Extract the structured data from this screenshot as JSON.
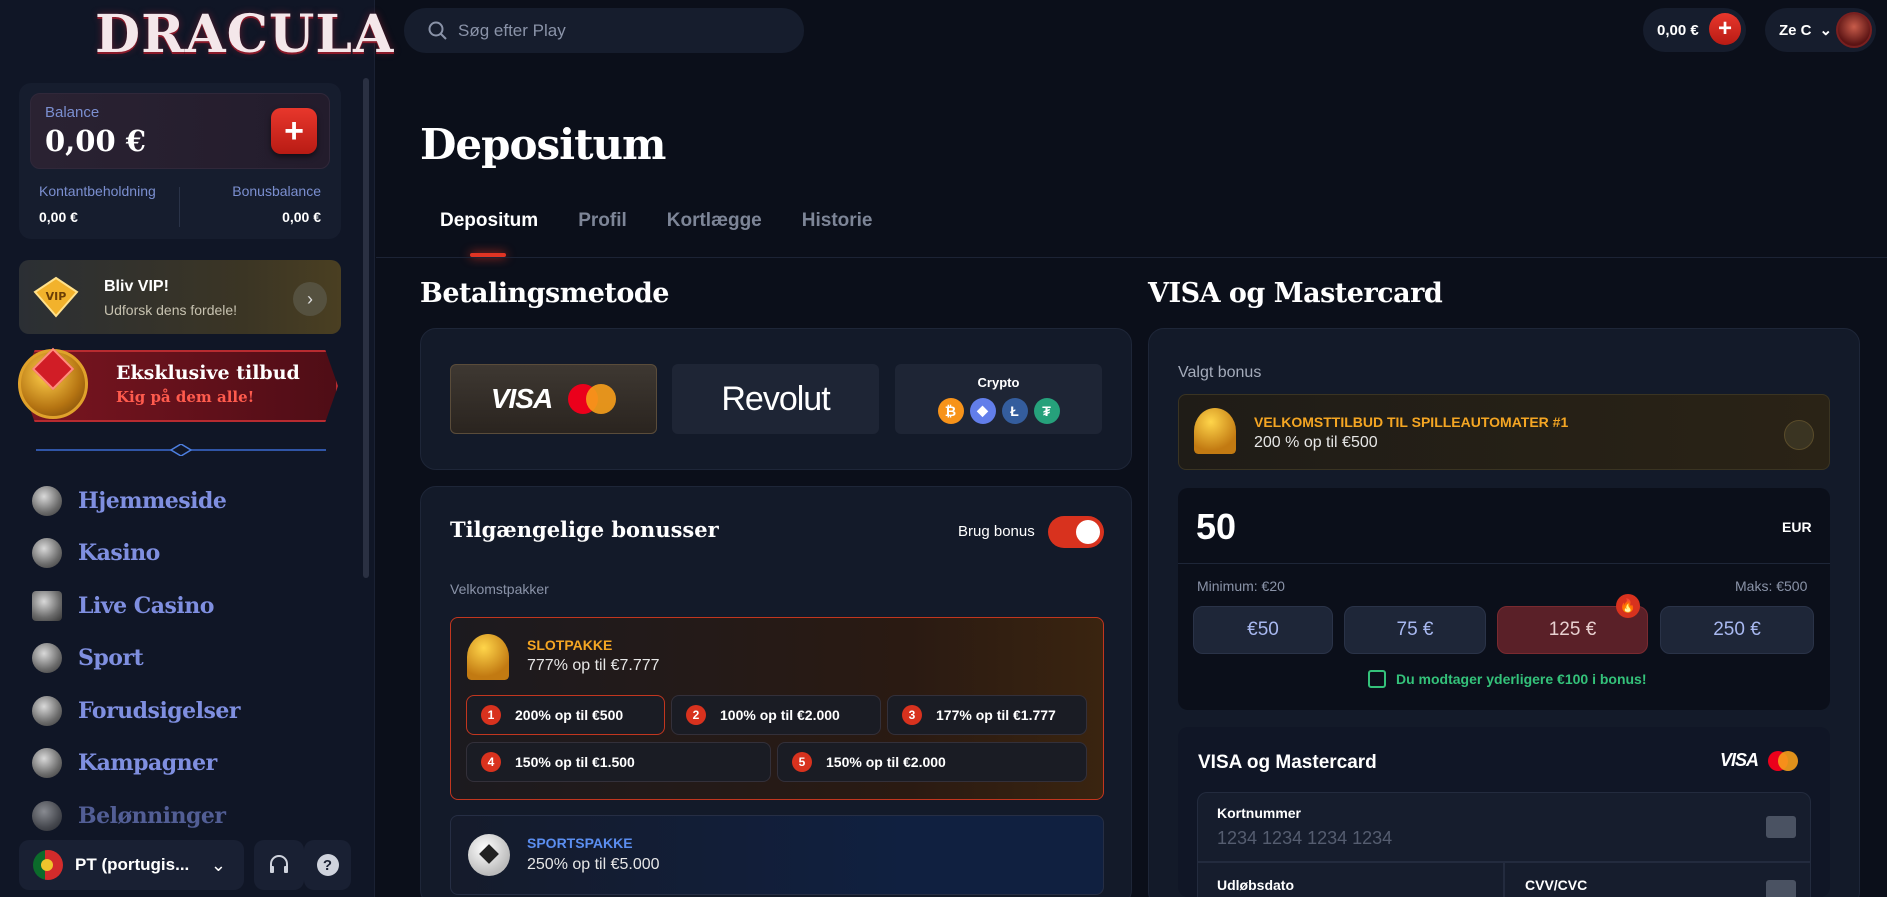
{
  "sidebar": {
    "logo": "DRACULA",
    "balance": {
      "label": "Balance",
      "value": "0,00 €"
    },
    "cash": {
      "label": "Kontantbeholdning",
      "value": "0,00 €"
    },
    "bonus": {
      "label": "Bonusbalance",
      "value": "0,00 €"
    },
    "vip": {
      "badge": "VIP",
      "title": "Bliv VIP!",
      "subtitle": "Udforsk dens fordele!"
    },
    "offers": {
      "title": "Eksklusive tilbud",
      "subtitle": "Kig på dem alle!"
    },
    "nav": [
      "Hjemmeside",
      "Kasino",
      "Live Casino",
      "Sport",
      "Forudsigelser",
      "Kampagner",
      "Belønninger"
    ],
    "language": "PT (portugis..."
  },
  "topbar": {
    "search_placeholder": "Søg efter Play",
    "balance": "0,00 €",
    "user": "Ze C"
  },
  "main": {
    "title": "Depositum",
    "tabs": [
      "Depositum",
      "Profil",
      "Kortlægge",
      "Historie"
    ],
    "payment_title": "Betalingsmetode",
    "methods": {
      "visa": "VISA",
      "mastercard": "mastercard",
      "revolut": "Revolut",
      "crypto": "Crypto"
    },
    "bonuses": {
      "title": "Tilgængelige bonusser",
      "toggle_label": "Brug bonus",
      "toggle_on": true,
      "section": "Velkomstpakker",
      "slot": {
        "title": "SLOTPAKKE",
        "subtitle": "777% op til €7.777",
        "steps": [
          "200% op til €500",
          "100% op til €2.000",
          "177% op til €1.777",
          "150% op til €1.500",
          "150% op til €2.000"
        ]
      },
      "sport": {
        "title": "SPORTSPAKKE",
        "subtitle": "250% op til €5.000"
      }
    }
  },
  "right": {
    "title": "VISA og Mastercard",
    "selected_label": "Valgt bonus",
    "offer": {
      "title": "VELKOMSTTILBUD TIL SPILLEAUTOMATER #1",
      "subtitle": "200 % op til €500"
    },
    "amount": "50",
    "currency": "EUR",
    "min": "Minimum: €20",
    "max": "Maks: €500",
    "presets": [
      "€50",
      "75 €",
      "125 €",
      "250 €"
    ],
    "extra": "Du modtager yderligere €100 i bonus!",
    "card": {
      "title": "VISA og Mastercard",
      "number_label": "Kortnummer",
      "number_placeholder": "1234 1234 1234 1234",
      "expiry_label": "Udløbsdato",
      "cvc_label": "CVV/CVC"
    }
  },
  "colors": {
    "accent": "#d8321e",
    "link": "#7f8fe0",
    "gold": "#f5a623",
    "green": "#34c27a"
  }
}
